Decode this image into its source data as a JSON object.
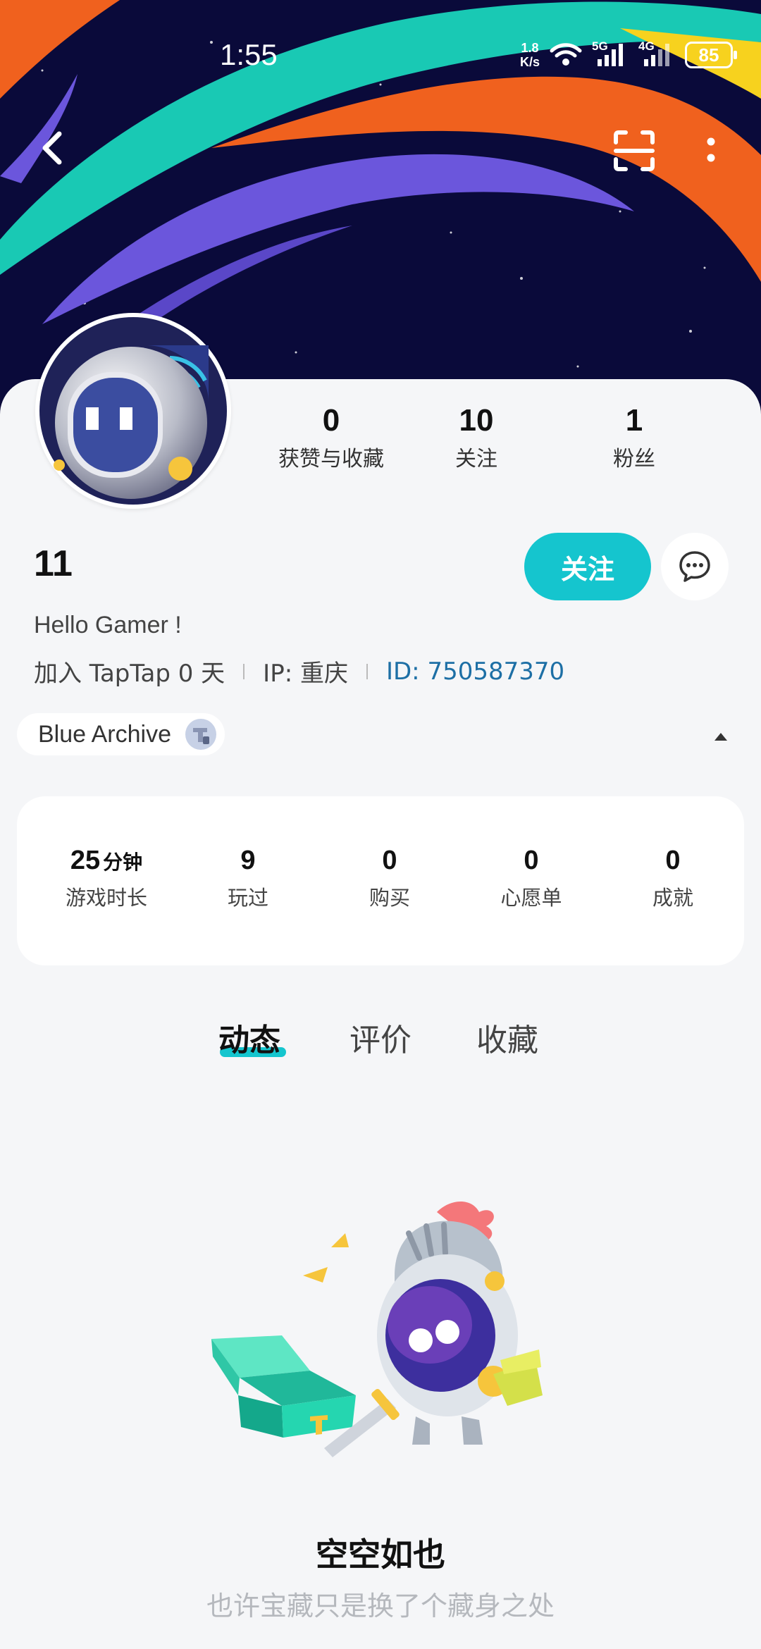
{
  "status_bar": {
    "time": "1:55",
    "net_speed_value": "1.8",
    "net_speed_unit": "K/s",
    "signal_5g": "5G",
    "signal_4g": "4G",
    "battery": "85"
  },
  "nav": {
    "back_icon": "chevron-left-icon",
    "scan_icon": "scan-icon",
    "more_icon": "more-vertical-icon"
  },
  "profile": {
    "stats": [
      {
        "value": "0",
        "label": "获赞与收藏"
      },
      {
        "value": "10",
        "label": "关注"
      },
      {
        "value": "1",
        "label": "粉丝"
      }
    ],
    "username": "11",
    "follow_label": "关注",
    "bio": "Hello Gamer !",
    "meta": {
      "joined": "加入 TapTap 0 天",
      "ip": "IP:  重庆",
      "id": "ID:  750587370"
    }
  },
  "game_chip": {
    "name": "Blue Archive"
  },
  "game_stats": [
    {
      "value": "25",
      "unit": "分钟",
      "label": "游戏时长"
    },
    {
      "value": "9",
      "unit": "",
      "label": "玩过"
    },
    {
      "value": "0",
      "unit": "",
      "label": "购买"
    },
    {
      "value": "0",
      "unit": "",
      "label": "心愿单"
    },
    {
      "value": "0",
      "unit": "",
      "label": "成就"
    }
  ],
  "tabs": [
    {
      "label": "动态",
      "active": true
    },
    {
      "label": "评价",
      "active": false
    },
    {
      "label": "收藏",
      "active": false
    }
  ],
  "empty_state": {
    "title": "空空如也",
    "subtitle": "也许宝藏只是换了个藏身之处"
  },
  "colors": {
    "accent": "#15c5ce",
    "id_link": "#1d6fa5",
    "banner_bg": "#0a0a3a"
  }
}
